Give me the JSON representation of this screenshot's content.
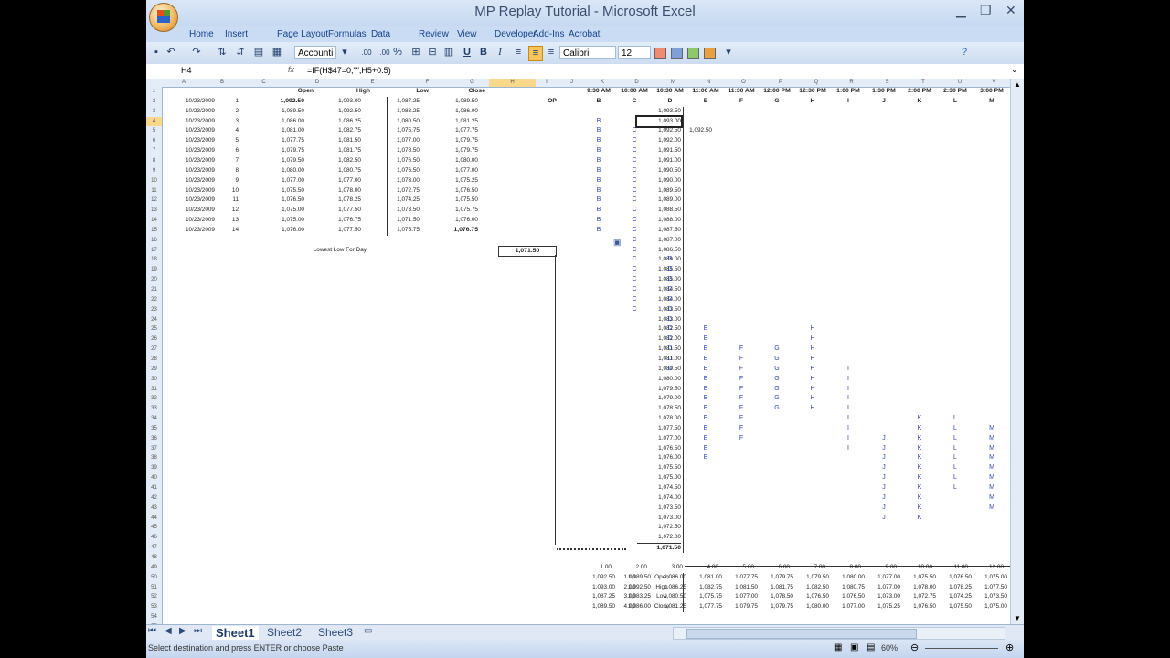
{
  "window": {
    "title": "MP Replay Tutorial - Microsoft Excel",
    "minimize": "▁",
    "restore": "❐",
    "close": "✕"
  },
  "ribbon": {
    "tabs": [
      "Home",
      "Insert",
      "Page Layout",
      "Formulas",
      "Data",
      "Review",
      "View",
      "Developer",
      "Add-Ins",
      "Acrobat"
    ],
    "number_format": "Accounti",
    "font_name": "Calibri",
    "font_size": "12",
    "bold": "B",
    "italic": "I",
    "underline": "U",
    "percent": "%",
    "inc_dec": ".00",
    "swatch_colors": [
      "#f08a70",
      "#7f9fd6",
      "#8fc86a",
      "#e9a040"
    ]
  },
  "formula_bar": {
    "name_box": "H4",
    "fx": "fx",
    "formula": "=IF(H$47=0,\"\",H5+0.5)"
  },
  "columns": [
    "A",
    "B",
    "C",
    "D",
    "E",
    "F",
    "G",
    "H",
    "I",
    "J",
    "K",
    "D",
    "M",
    "N",
    "O",
    "P",
    "Q",
    "R",
    "S",
    "T",
    "U",
    "V"
  ],
  "rows": [
    "1",
    "2",
    "3",
    "4",
    "5",
    "6",
    "7",
    "8",
    "9",
    "10",
    "11",
    "12",
    "13",
    "14",
    "15",
    "16",
    "17",
    "18",
    "19",
    "20",
    "21",
    "22",
    "23",
    "24",
    "25",
    "26",
    "27",
    "28",
    "29",
    "30",
    "31",
    "32",
    "33",
    "34",
    "35",
    "36",
    "37",
    "38",
    "39",
    "40",
    "41",
    "42",
    "43",
    "44",
    "45",
    "46",
    "47",
    "48",
    "49",
    "50",
    "51",
    "52",
    "53",
    "54",
    "55"
  ],
  "headers": {
    "open": "Open",
    "high": "High",
    "low": "Low",
    "close": "Close"
  },
  "bars": [
    [
      "10/23/2009",
      "1",
      "1,092.50",
      "1,093.00",
      "1,087.25",
      "1,089.50"
    ],
    [
      "10/23/2009",
      "2",
      "1,089.50",
      "1,092.50",
      "1,083.25",
      "1,086.00"
    ],
    [
      "10/23/2009",
      "3",
      "1,086.00",
      "1,086.25",
      "1,080.50",
      "1,081.25"
    ],
    [
      "10/23/2009",
      "4",
      "1,081.00",
      "1,082.75",
      "1,075.75",
      "1,077.75"
    ],
    [
      "10/23/2009",
      "5",
      "1,077.75",
      "1,081.50",
      "1,077.00",
      "1,079.75"
    ],
    [
      "10/23/2009",
      "6",
      "1,079.75",
      "1,081.75",
      "1,078.50",
      "1,079.75"
    ],
    [
      "10/23/2009",
      "7",
      "1,079.50",
      "1,082.50",
      "1,076.50",
      "1,080.00"
    ],
    [
      "10/23/2009",
      "8",
      "1,080.00",
      "1,080.75",
      "1,076.50",
      "1,077.00"
    ],
    [
      "10/23/2009",
      "9",
      "1,077.00",
      "1,077.00",
      "1,073.00",
      "1,075.25"
    ],
    [
      "10/23/2009",
      "10",
      "1,075.50",
      "1,078.00",
      "1,072.75",
      "1,076.50"
    ],
    [
      "10/23/2009",
      "11",
      "1,076.50",
      "1,078.25",
      "1,074.25",
      "1,075.50"
    ],
    [
      "10/23/2009",
      "12",
      "1,075.00",
      "1,077.50",
      "1,073.50",
      "1,075.75"
    ],
    [
      "10/23/2009",
      "13",
      "1,075.00",
      "1,076.75",
      "1,071.50",
      "1,076.00"
    ],
    [
      "10/23/2009",
      "14",
      "1,076.00",
      "1,077.50",
      "1,075.75",
      "1,076.75"
    ]
  ],
  "lowest_low_label": "Lowest Low For Day",
  "lowest_low": "1,071.50",
  "op_label": "OP",
  "op_value": "1,092.50",
  "time_labels": [
    "9:30 AM",
    "10:00 AM",
    "10:30 AM",
    "11:00 AM",
    "11:30 AM",
    "12:00 PM",
    "12:30 PM",
    "1:00 PM",
    "1:30 PM",
    "2:00 PM",
    "2:30 PM",
    "3:00 PM",
    "3:"
  ],
  "period_letters": [
    "B",
    "C",
    "D",
    "E",
    "F",
    "G",
    "H",
    "I",
    "J",
    "K",
    "L",
    "M"
  ],
  "letter_columns": [
    "B",
    "C",
    "D",
    "E",
    "F",
    "G",
    "H",
    "I",
    "J",
    "K",
    "L",
    "M"
  ],
  "prices": [
    "1,093.50",
    "1,093.00",
    "1,092.50",
    "1,092.00",
    "1,091.50",
    "1,091.00",
    "1,090.50",
    "1,090.00",
    "1,089.50",
    "1,089.00",
    "1,088.50",
    "1,088.00",
    "1,087.50",
    "1,087.00",
    "1,086.50",
    "1,086.00",
    "1,085.50",
    "1,085.00",
    "1,084.50",
    "1,084.00",
    "1,083.50",
    "1,083.00",
    "1,082.50",
    "1,082.00",
    "1,081.50",
    "1,081.00",
    "1,080.50",
    "1,080.00",
    "1,079.50",
    "1,079.00",
    "1,078.50",
    "1,078.00",
    "1,077.50",
    "1,077.00",
    "1,076.50",
    "1,076.00",
    "1,075.50",
    "1,075.00",
    "1,074.50",
    "1,074.00",
    "1,073.50",
    "1,073.00",
    "1,072.50",
    "1,072.00",
    "1,071.50"
  ],
  "profile": [
    {
      "letter": "B",
      "col": 0,
      "rows": [
        4,
        5,
        6,
        7,
        8,
        9,
        10,
        11,
        12,
        13,
        14,
        15
      ]
    },
    {
      "letter": "C",
      "col": 1,
      "rows": [
        5,
        6,
        7,
        8,
        9,
        10,
        11,
        12,
        13,
        14,
        15,
        16,
        17,
        18,
        19,
        20,
        21,
        22,
        23
      ]
    },
    {
      "letter": "D",
      "col": 2,
      "rows": [
        18,
        19,
        20,
        21,
        22,
        23,
        24,
        25,
        26,
        27,
        28,
        29
      ]
    },
    {
      "letter": "E",
      "col": 3,
      "rows": [
        25,
        26,
        27,
        28,
        29,
        30,
        31,
        32,
        33,
        34,
        35,
        36,
        37,
        38
      ]
    },
    {
      "letter": "F",
      "col": 4,
      "rows": [
        27,
        28,
        29,
        30,
        31,
        32,
        33,
        34,
        35,
        36
      ]
    },
    {
      "letter": "G",
      "col": 5,
      "rows": [
        27,
        28,
        29,
        30,
        31,
        32,
        33
      ]
    },
    {
      "letter": "H",
      "col": 6,
      "rows": [
        25,
        26,
        27,
        28,
        29,
        30,
        31,
        32,
        33
      ]
    },
    {
      "letter": "I",
      "col": 7,
      "rows": [
        29,
        30,
        31,
        32,
        33,
        34,
        35,
        36,
        37
      ]
    },
    {
      "letter": "J",
      "col": 8,
      "rows": [
        36,
        37,
        38,
        39,
        40,
        41,
        42,
        43,
        44
      ]
    },
    {
      "letter": "K",
      "col": 9,
      "rows": [
        34,
        35,
        36,
        37,
        38,
        39,
        40,
        41,
        42,
        43,
        44
      ]
    },
    {
      "letter": "L",
      "col": 10,
      "rows": [
        34,
        35,
        36,
        37,
        38,
        39,
        40,
        41
      ]
    },
    {
      "letter": "M",
      "col": 11,
      "rows": [
        35,
        36,
        37,
        38,
        39,
        40,
        41,
        42,
        43
      ]
    }
  ],
  "summary": {
    "period_numbers": [
      "1.00",
      "2.00",
      "3.00",
      "4.00",
      "5.00",
      "6.00",
      "7.00",
      "8.00",
      "9.00",
      "10.00",
      "11.00",
      "12.00"
    ],
    "row_keys": [
      "1.00",
      "2.00",
      "3.00",
      "4.00"
    ],
    "row_labels": [
      "Open",
      "High",
      "Low",
      "Close"
    ],
    "open": [
      "1,092.50",
      "1,089.50",
      "1,086.00",
      "1,081.00",
      "1,077.75",
      "1,079.75",
      "1,079.50",
      "1,080.00",
      "1,077.00",
      "1,075.50",
      "1,076.50",
      "1,075.00"
    ],
    "high": [
      "1,093.00",
      "1,092.50",
      "1,086.25",
      "1,082.75",
      "1,081.50",
      "1,081.75",
      "1,082.50",
      "1,080.75",
      "1,077.00",
      "1,078.00",
      "1,078.25",
      "1,077.50"
    ],
    "low": [
      "1,087.25",
      "1,083.25",
      "1,080.50",
      "1,075.75",
      "1,077.00",
      "1,078.50",
      "1,076.50",
      "1,076.50",
      "1,073.00",
      "1,072.75",
      "1,074.25",
      "1,073.50"
    ],
    "close": [
      "1,089.50",
      "1,086.00",
      "1,081.25",
      "1,077.75",
      "1,079.75",
      "1,079.75",
      "1,080.00",
      "1,077.00",
      "1,075.25",
      "1,076.50",
      "1,075.50",
      "1,075.00"
    ]
  },
  "sheet_tabs": [
    "Sheet1",
    "Sheet2",
    "Sheet3"
  ],
  "status": {
    "message": "Select destination and press ENTER or choose Paste",
    "zoom": "60%"
  }
}
